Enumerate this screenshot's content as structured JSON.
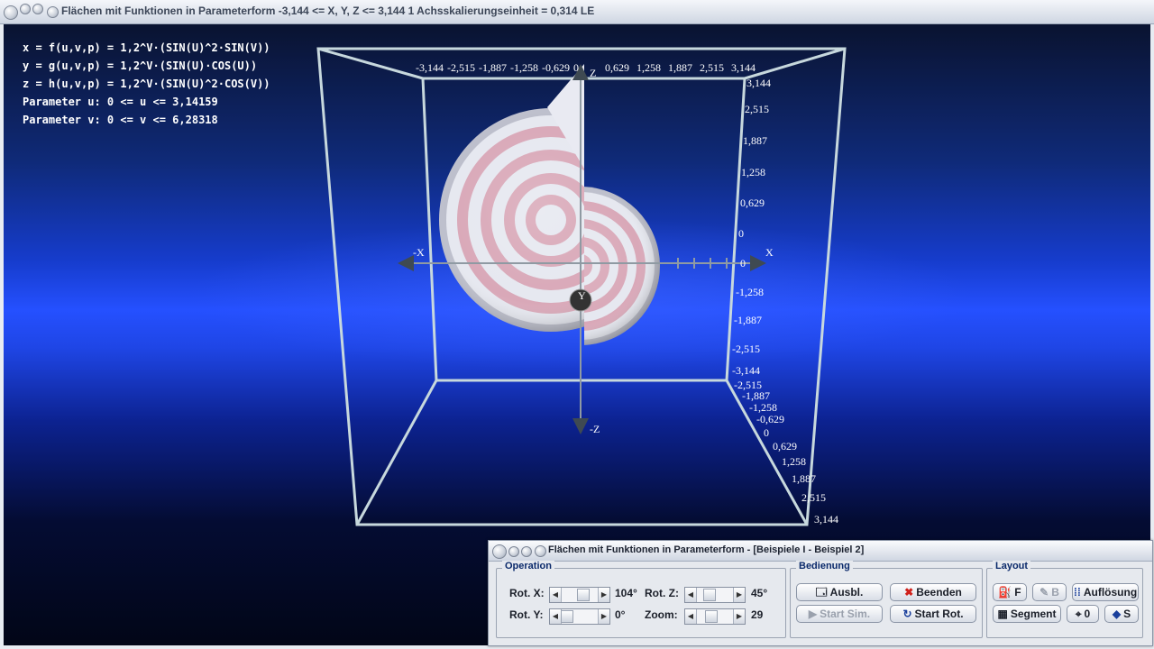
{
  "main_window": {
    "title": "Flächen mit Funktionen in Parameterform   -3,144 <= X, Y, Z <= 3,144    1 Achsskalierungseinheit = 0,314 LE"
  },
  "formulas": {
    "x": "x = f(u,v,p) = 1,2^V·(SIN(U)^2·SIN(V))",
    "y": "y = g(u,v,p) = 1,2^V·(SIN(U)·COS(U))",
    "z": "z = h(u,v,p) = 1,2^V·(SIN(U)^2·COS(V))",
    "param_u": "Parameter u: 0 <= u <= 3,14159",
    "param_v": "Parameter v: 0 <= v <= 6,28318"
  },
  "scene": {
    "top_ticks": [
      "-3,144",
      "-2,515",
      "-1,887",
      "-1,258",
      "-0,629",
      "0",
      "0,629",
      "1,258",
      "1,887",
      "2,515",
      "3,144"
    ],
    "right_ticks": [
      "3,144",
      "2,515",
      "1,887",
      "1,258",
      "0,629",
      "0",
      "0",
      "-1,258",
      "-1,887",
      "-2,515",
      "-3,144"
    ],
    "depth_ticks": [
      "-2,515",
      "-1,887",
      "-1,258",
      "-0,629",
      "0",
      "0,629",
      "1,258",
      "1,887",
      "2,515",
      "3,144"
    ],
    "axis_labels": {
      "x_pos": "X",
      "x_neg": "-X",
      "z_pos": "Z",
      "z_neg": "-Z",
      "y_pos": "Y"
    },
    "colors": {
      "stripe_pink": "#d9a8b8",
      "stripe_white": "#e6e8f0",
      "frame": "#c7d8dd"
    }
  },
  "control_window": {
    "title": "Flächen mit Funktionen in Parameterform - [Beispiele I - Beispiel 2]",
    "operation": {
      "title": "Operation",
      "rot_x_label": "Rot. X:",
      "rot_x_value": "104°",
      "rot_y_label": "Rot. Y:",
      "rot_y_value": "0°",
      "rot_z_label": "Rot. Z:",
      "rot_z_value": "45°",
      "zoom_label": "Zoom:",
      "zoom_value": "29"
    },
    "bedienung": {
      "title": "Bedienung",
      "ausbl": "Ausbl.",
      "beenden": "Beenden",
      "start_sim": "Start Sim.",
      "start_rot": "Start Rot."
    },
    "layout": {
      "title": "Layout",
      "f": "F",
      "b": "B",
      "aufloesung": "Auflösung",
      "segment": "Segment",
      "zero": "0",
      "s": "S"
    }
  }
}
